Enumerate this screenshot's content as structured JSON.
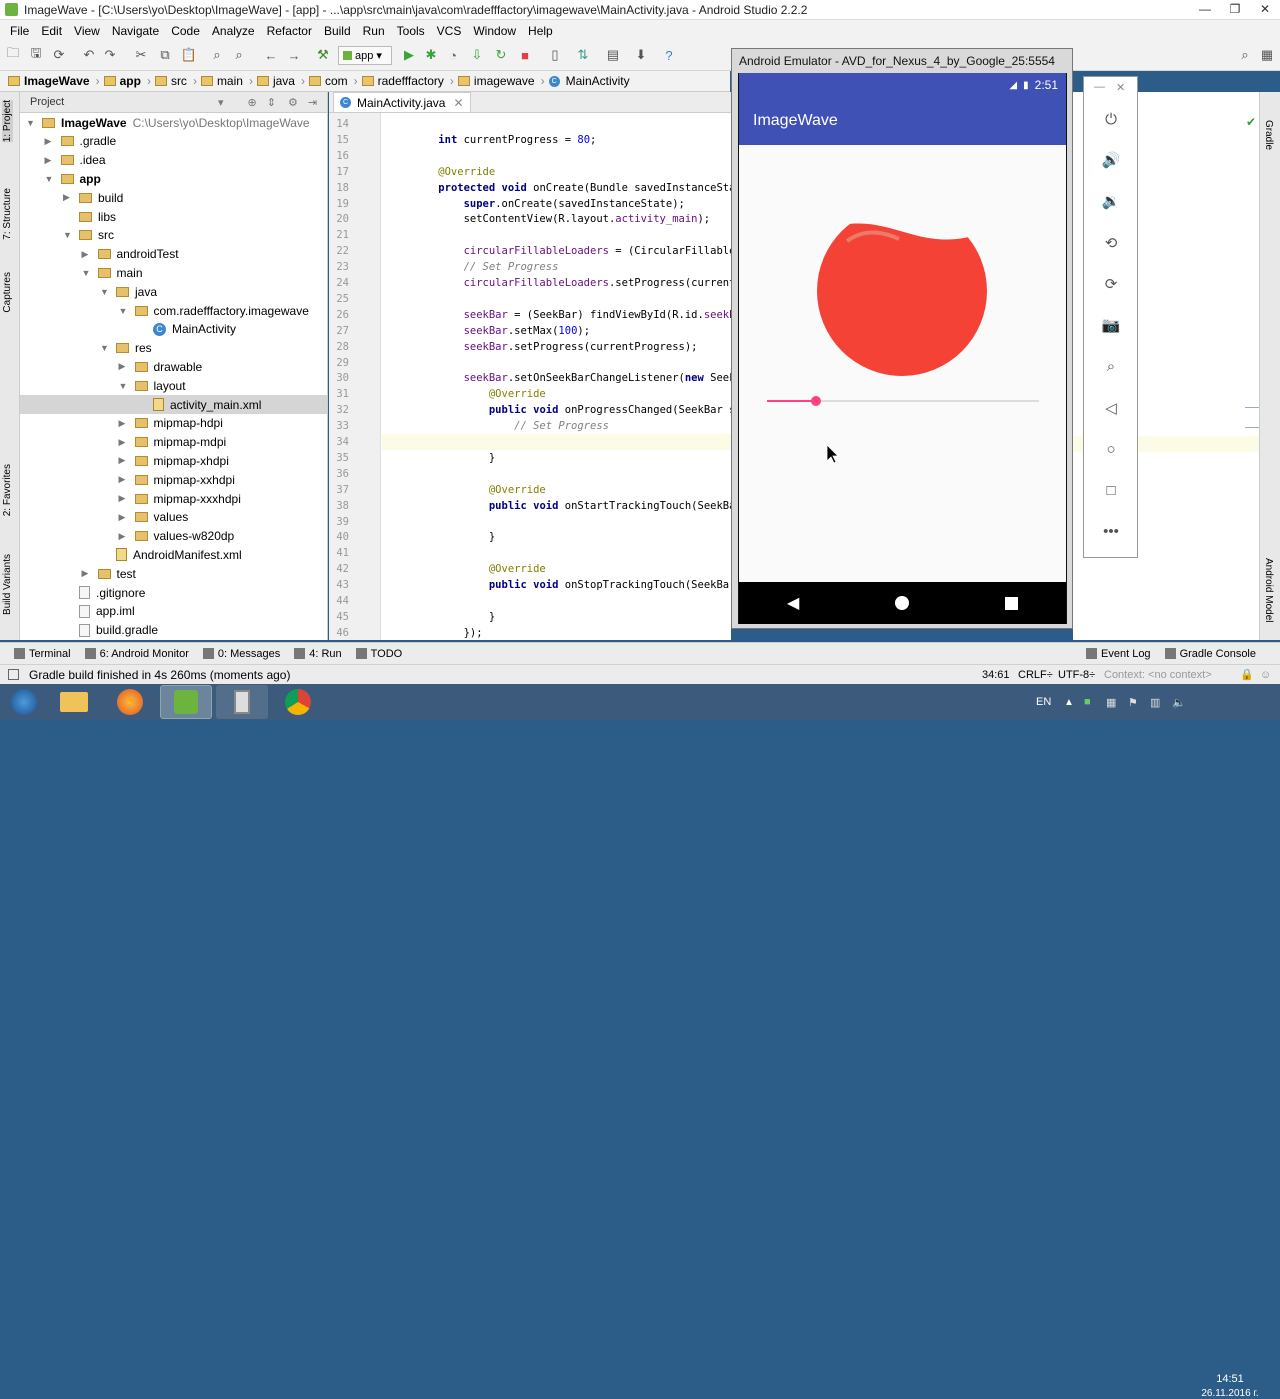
{
  "window": {
    "title": "ImageWave - [C:\\Users\\yo\\Desktop\\ImageWave] - [app] - ...\\app\\src\\main\\java\\com\\radefffactory\\imagewave\\MainActivity.java - Android Studio 2.2.2"
  },
  "menu": [
    "File",
    "Edit",
    "View",
    "Navigate",
    "Code",
    "Analyze",
    "Refactor",
    "Build",
    "Run",
    "Tools",
    "VCS",
    "Window",
    "Help"
  ],
  "toolbar": {
    "config": "app"
  },
  "breadcrumbs": [
    "ImageWave",
    "app",
    "src",
    "main",
    "java",
    "com",
    "radefffactory",
    "imagewave",
    "MainActivity"
  ],
  "left_tools": [
    "1: Project",
    "7: Structure",
    "Captures",
    "2: Favorites",
    "Build Variants"
  ],
  "right_tools": [
    "Gradle",
    "Android Model"
  ],
  "project": {
    "header": "Project",
    "root": {
      "name": "ImageWave",
      "path": "C:\\Users\\yo\\Desktop\\ImageWave"
    },
    "tree": [
      {
        "label": "ImageWave",
        "depth": 0,
        "kind": "folder",
        "expanded": true
      },
      {
        "label": ".gradle",
        "depth": 1,
        "kind": "folder",
        "expanded": false
      },
      {
        "label": ".idea",
        "depth": 1,
        "kind": "folder",
        "expanded": false
      },
      {
        "label": "app",
        "depth": 1,
        "kind": "folder",
        "expanded": true
      },
      {
        "label": "build",
        "depth": 2,
        "kind": "folder",
        "expanded": false
      },
      {
        "label": "libs",
        "depth": 2,
        "kind": "folder",
        "expanded": null
      },
      {
        "label": "src",
        "depth": 2,
        "kind": "folder",
        "expanded": true
      },
      {
        "label": "androidTest",
        "depth": 3,
        "kind": "folder",
        "expanded": false
      },
      {
        "label": "main",
        "depth": 3,
        "kind": "folder",
        "expanded": true
      },
      {
        "label": "java",
        "depth": 4,
        "kind": "folder",
        "expanded": true
      },
      {
        "label": "com.radefffactory.imagewave",
        "depth": 5,
        "kind": "folder",
        "expanded": true
      },
      {
        "label": "MainActivity",
        "depth": 6,
        "kind": "class",
        "expanded": null
      },
      {
        "label": "res",
        "depth": 4,
        "kind": "folder",
        "expanded": true
      },
      {
        "label": "drawable",
        "depth": 5,
        "kind": "folder",
        "expanded": false
      },
      {
        "label": "layout",
        "depth": 5,
        "kind": "folder",
        "expanded": true
      },
      {
        "label": "activity_main.xml",
        "depth": 6,
        "kind": "xml",
        "expanded": null,
        "selected": true
      },
      {
        "label": "mipmap-hdpi",
        "depth": 5,
        "kind": "folder",
        "expanded": false
      },
      {
        "label": "mipmap-mdpi",
        "depth": 5,
        "kind": "folder",
        "expanded": false
      },
      {
        "label": "mipmap-xhdpi",
        "depth": 5,
        "kind": "folder",
        "expanded": false
      },
      {
        "label": "mipmap-xxhdpi",
        "depth": 5,
        "kind": "folder",
        "expanded": false
      },
      {
        "label": "mipmap-xxxhdpi",
        "depth": 5,
        "kind": "folder",
        "expanded": false
      },
      {
        "label": "values",
        "depth": 5,
        "kind": "folder",
        "expanded": false
      },
      {
        "label": "values-w820dp",
        "depth": 5,
        "kind": "folder",
        "expanded": false
      },
      {
        "label": "AndroidManifest.xml",
        "depth": 4,
        "kind": "xml",
        "expanded": null
      },
      {
        "label": "test",
        "depth": 3,
        "kind": "folder",
        "expanded": false
      },
      {
        "label": ".gitignore",
        "depth": 2,
        "kind": "file",
        "expanded": null
      },
      {
        "label": "app.iml",
        "depth": 2,
        "kind": "file",
        "expanded": null
      },
      {
        "label": "build.gradle",
        "depth": 2,
        "kind": "file",
        "expanded": null
      }
    ]
  },
  "editor": {
    "tab": "MainActivity.java",
    "lines": [
      {
        "n": "14",
        "code": ""
      },
      {
        "n": "15",
        "code": "    int currentProgress = 80;"
      },
      {
        "n": "16",
        "code": ""
      },
      {
        "n": "17",
        "code": "    @Override"
      },
      {
        "n": "18",
        "code": "    protected void onCreate(Bundle savedInstanceState"
      },
      {
        "n": "19",
        "code": "        super.onCreate(savedInstanceState);"
      },
      {
        "n": "20",
        "code": "        setContentView(R.layout.activity_main);"
      },
      {
        "n": "21",
        "code": ""
      },
      {
        "n": "22",
        "code": "        circularFillableLoaders = (CircularFillableLo"
      },
      {
        "n": "23",
        "code": "        // Set Progress"
      },
      {
        "n": "24",
        "code": "        circularFillableLoaders.setProgress(currentPr"
      },
      {
        "n": "25",
        "code": ""
      },
      {
        "n": "26",
        "code": "        seekBar = (SeekBar) findViewById(R.id.seekBar"
      },
      {
        "n": "27",
        "code": "        seekBar.setMax(100);"
      },
      {
        "n": "28",
        "code": "        seekBar.setProgress(currentProgress);"
      },
      {
        "n": "29",
        "code": ""
      },
      {
        "n": "30",
        "code": "        seekBar.setOnSeekBarChangeListener(new SeekBa"
      },
      {
        "n": "31",
        "code": "            @Override"
      },
      {
        "n": "32",
        "code": "            public void onProgressChanged(SeekBar see"
      },
      {
        "n": "33",
        "code": "                // Set Progress"
      },
      {
        "n": "34",
        "code": "                circularFillableLoaders.setProgress(p"
      },
      {
        "n": "35",
        "code": "            }"
      },
      {
        "n": "36",
        "code": ""
      },
      {
        "n": "37",
        "code": "            @Override"
      },
      {
        "n": "38",
        "code": "            public void onStartTrackingTouch(SeekBar"
      },
      {
        "n": "39",
        "code": ""
      },
      {
        "n": "40",
        "code": "            }"
      },
      {
        "n": "41",
        "code": ""
      },
      {
        "n": "42",
        "code": "            @Override"
      },
      {
        "n": "43",
        "code": "            public void onStopTrackingTouch(SeekBar s"
      },
      {
        "n": "44",
        "code": ""
      },
      {
        "n": "45",
        "code": "            }"
      },
      {
        "n": "46",
        "code": "        });"
      }
    ]
  },
  "bottom_tools": [
    "Terminal",
    "6: Android Monitor",
    "0: Messages",
    "4: Run",
    "TODO",
    "Event Log",
    "Gradle Console"
  ],
  "status": {
    "message": "Gradle build finished in 4s 260ms (moments ago)",
    "position": "34:61",
    "line_sep": "CRLF÷",
    "encoding": "UTF-8÷",
    "context": "Context: <no context>"
  },
  "emulator": {
    "title": "Android Emulator - AVD_for_Nexus_4_by_Google_25:5554",
    "time": "2:51",
    "app_title": "ImageWave",
    "seekbar_progress": 0.18,
    "loader_fill": 0.85,
    "colors": {
      "primary": "#3f51b5",
      "accent": "#ff4081",
      "loader": "#f44336"
    }
  },
  "emulator_side": [
    "power-icon",
    "volume-up-icon",
    "volume-down-icon",
    "rotate-left-icon",
    "rotate-right-icon",
    "camera-icon",
    "zoom-icon",
    "back-icon",
    "home-icon",
    "overview-icon",
    "more-icon"
  ],
  "taskbar": {
    "lang": "EN",
    "time": "14:51",
    "date": "26.11.2016 г."
  }
}
